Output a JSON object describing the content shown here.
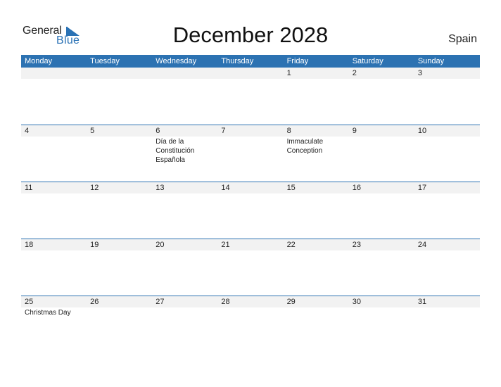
{
  "logo": {
    "line1": "General",
    "line2": "Blue",
    "brand_color": "#2a72b5"
  },
  "header": {
    "title": "December 2028",
    "country": "Spain"
  },
  "colors": {
    "header_bar": "#2c72b2",
    "date_strip": "#f2f2f2"
  },
  "calendar": {
    "weekdays": [
      "Monday",
      "Tuesday",
      "Wednesday",
      "Thursday",
      "Friday",
      "Saturday",
      "Sunday"
    ],
    "weeks": [
      [
        {
          "day": "",
          "event": ""
        },
        {
          "day": "",
          "event": ""
        },
        {
          "day": "",
          "event": ""
        },
        {
          "day": "",
          "event": ""
        },
        {
          "day": "1",
          "event": ""
        },
        {
          "day": "2",
          "event": ""
        },
        {
          "day": "3",
          "event": ""
        }
      ],
      [
        {
          "day": "4",
          "event": ""
        },
        {
          "day": "5",
          "event": ""
        },
        {
          "day": "6",
          "event": "Día de la\nConstitución\nEspañola"
        },
        {
          "day": "7",
          "event": ""
        },
        {
          "day": "8",
          "event": "Immaculate\nConception"
        },
        {
          "day": "9",
          "event": ""
        },
        {
          "day": "10",
          "event": ""
        }
      ],
      [
        {
          "day": "11",
          "event": ""
        },
        {
          "day": "12",
          "event": ""
        },
        {
          "day": "13",
          "event": ""
        },
        {
          "day": "14",
          "event": ""
        },
        {
          "day": "15",
          "event": ""
        },
        {
          "day": "16",
          "event": ""
        },
        {
          "day": "17",
          "event": ""
        }
      ],
      [
        {
          "day": "18",
          "event": ""
        },
        {
          "day": "19",
          "event": ""
        },
        {
          "day": "20",
          "event": ""
        },
        {
          "day": "21",
          "event": ""
        },
        {
          "day": "22",
          "event": ""
        },
        {
          "day": "23",
          "event": ""
        },
        {
          "day": "24",
          "event": ""
        }
      ],
      [
        {
          "day": "25",
          "event": "Christmas Day"
        },
        {
          "day": "26",
          "event": ""
        },
        {
          "day": "27",
          "event": ""
        },
        {
          "day": "28",
          "event": ""
        },
        {
          "day": "29",
          "event": ""
        },
        {
          "day": "30",
          "event": ""
        },
        {
          "day": "31",
          "event": ""
        }
      ]
    ]
  }
}
